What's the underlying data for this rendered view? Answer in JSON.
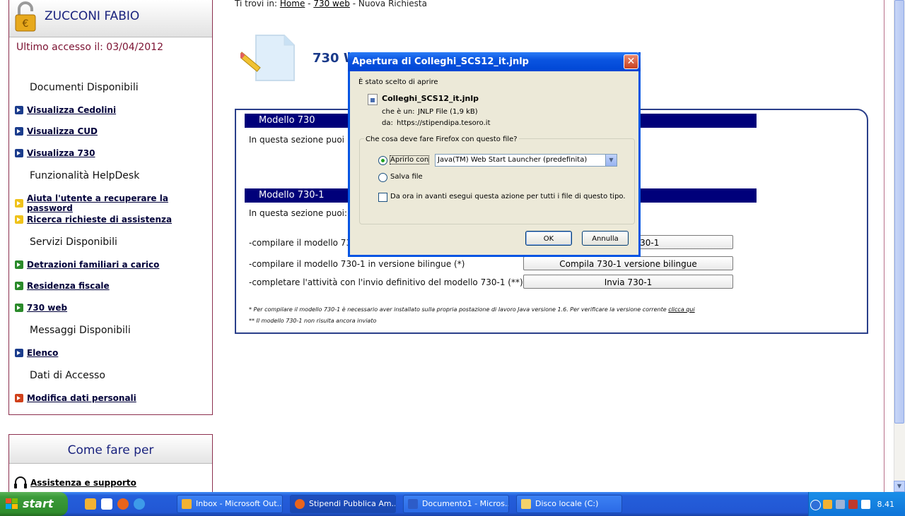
{
  "user": {
    "name": "ZUCCONI FABIO",
    "last_access": "Ultimo accesso il: 03/04/2012"
  },
  "sidebar": {
    "sections": [
      {
        "title": "Documenti Disponibili",
        "links": [
          {
            "label": "Visualizza Cedolini",
            "color": "#1b3c8c"
          },
          {
            "label": "Visualizza CUD",
            "color": "#1b3c8c"
          },
          {
            "label": "Visualizza 730",
            "color": "#1b3c8c"
          }
        ]
      },
      {
        "title": "Funzionalità HelpDesk",
        "links": [
          {
            "label": "Aiuta l'utente a recuperare la password",
            "color": "#efc21a"
          },
          {
            "label": "Ricerca richieste di assistenza",
            "color": "#efc21a"
          }
        ]
      },
      {
        "title": "Servizi Disponibili",
        "links": [
          {
            "label": "Detrazioni familiari a carico",
            "color": "#2a8a2a"
          },
          {
            "label": "Residenza fiscale",
            "color": "#2a8a2a"
          },
          {
            "label": "730 web",
            "color": "#2a8a2a"
          }
        ]
      },
      {
        "title": "Messaggi Disponibili",
        "links": [
          {
            "label": "Elenco",
            "color": "#1b3c8c"
          }
        ]
      },
      {
        "title": "Dati di Accesso",
        "links": [
          {
            "label": "Modifica dati personali",
            "color": "#d0401a"
          }
        ]
      }
    ],
    "howto": {
      "title": "Come fare per",
      "support_link": "Assistenza e supporto"
    }
  },
  "breadcrumb": {
    "prefix": "Ti trovi in:",
    "home": "Home",
    "sep1": "-",
    "section": "730 web",
    "sep2": "-",
    "current": "Nuova Richiesta"
  },
  "page_title": "730 W",
  "panel": {
    "modello730": {
      "title": "Modello 730",
      "text": "In questa sezione puoi i"
    },
    "modello7301": {
      "title": "Modello 730-1",
      "text": "In questa sezione puoi:"
    },
    "rows": [
      {
        "text": "-compilare il modello 730",
        "button": "Compila 730-1"
      },
      {
        "text": "-compilare il modello 730-1 in versione bilingue (*)",
        "button": "Compila 730-1 versione bilingue"
      },
      {
        "text": "-completare l'attività con l'invio definitivo del modello 730-1 (**)",
        "button": "Invia 730-1"
      }
    ],
    "note1": "* Per compilare il modello 730-1 è necessario aver installato sulla propria postazione di lavoro Java versione 1.6. Per verificare la versione corrente",
    "note1_link": "clicca qui",
    "note2": "** Il modello 730-1 non risulta ancora inviato"
  },
  "dialog": {
    "title": "Apertura di Colleghi_SCS12_it.jnlp",
    "chosen_label": "È stato scelto di aprire",
    "file_name": "Colleghi_SCS12_it.jnlp",
    "type_label": "che è un:",
    "type_value": "JNLP File (1,9 kB)",
    "from_label": "da:",
    "from_value": "https://stipendipa.tesoro.it",
    "question": "Che cosa deve fare Firefox con questo file?",
    "open_with_label": "Aprirlo con",
    "open_with_value": "Java(TM) Web Start Launcher (predefinita)",
    "save_label": "Salva file",
    "always_label": "Da ora in avanti esegui questa azione per tutti i file di questo tipo.",
    "ok": "OK",
    "cancel": "Annulla",
    "close": "✕"
  },
  "taskbar": {
    "start": "start",
    "tasks": [
      {
        "label": "Inbox - Microsoft Out...",
        "color": "#f2b233"
      },
      {
        "label": "Stipendi Pubblica Am...",
        "color": "#e8641c"
      },
      {
        "label": "Documento1 - Micros...",
        "color": "#2d5cc8"
      },
      {
        "label": "Disco locale (C:)",
        "color": "#f5d26a"
      }
    ],
    "clock": "8.41"
  }
}
